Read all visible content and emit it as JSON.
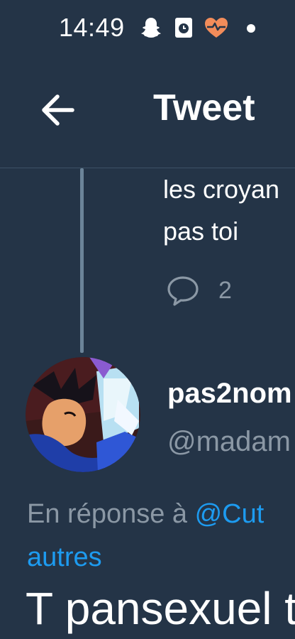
{
  "status_bar": {
    "time": "14:49",
    "icons": [
      "snapchat-icon",
      "clock-app-icon",
      "health-heart-icon",
      "notification-dot-icon"
    ],
    "health_icon_color": "#f28c5a"
  },
  "header": {
    "back_icon": "arrow-left-icon",
    "title": "Tweet"
  },
  "previous_tweet": {
    "text_line_1": "les croyan",
    "text_line_2": "pas toi",
    "reply_icon": "comment-bubble-icon",
    "reply_count": "2"
  },
  "main_tweet": {
    "author_name": "pas2nom",
    "author_handle": "@madam",
    "reply_to_label": "En réponse à ",
    "reply_to_mention": "@Cut",
    "reply_to_more": "autres",
    "body": "T pansexuel t"
  },
  "colors": {
    "background": "#243447",
    "link": "#1d9bf0",
    "secondary_text": "#8b98a5",
    "thread_line": "#6c8499"
  }
}
